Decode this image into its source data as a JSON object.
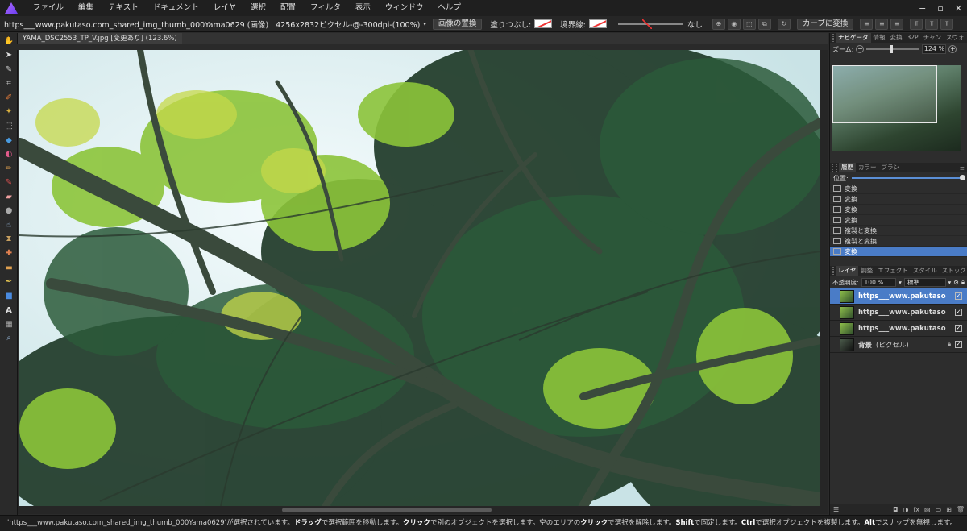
{
  "menu": [
    "ファイル",
    "編集",
    "テキスト",
    "ドキュメント",
    "レイヤ",
    "選択",
    "配置",
    "フィルタ",
    "表示",
    "ウィンドウ",
    "ヘルプ"
  ],
  "window_controls": [
    "−",
    "▫",
    "✕"
  ],
  "context": {
    "doc_name": "https___www.pakutaso.com_shared_img_thumb_000Yama0629 (画像)",
    "doc_info": "4256x2832ピクセル-@-300dpi-(100%)",
    "replace_button": "画像の置換",
    "fill_label": "塗りつぶし:",
    "stroke_label": "境界線:",
    "stroke_none": "なし",
    "convert_curves": "カーブに変換"
  },
  "doc_tab": "YAMA_DSC2553_TP_V.jpg [変更あり] (123.6%)",
  "navigator": {
    "tabs": [
      "ナビゲータ",
      "情報",
      "変換",
      "32P",
      "チャン",
      "スウォ"
    ],
    "active_tab": "ナビゲータ",
    "zoom_label": "ズーム:",
    "zoom_value": "124 %",
    "zoom_level": 0.46
  },
  "history": {
    "tabs": [
      "履歴",
      "カラー",
      "ブラシ"
    ],
    "position_label": "位置:",
    "items": [
      "変換",
      "変換",
      "変換",
      "変換",
      "複製と変換",
      "複製と変換",
      "変換"
    ],
    "selected_index": 6
  },
  "layers": {
    "tabs": [
      "レイヤ",
      "調整",
      "エフェクト",
      "スタイル",
      "ストック"
    ],
    "opacity_label": "不透明度:",
    "opacity_value": "100 %",
    "blend_mode": "標準",
    "items": [
      {
        "name": "https___www.pakutaso",
        "sub": "",
        "selected": true,
        "locked": false
      },
      {
        "name": "https___www.pakutaso",
        "sub": "",
        "selected": false,
        "locked": false
      },
      {
        "name": "https___www.pakutaso",
        "sub": "",
        "selected": false,
        "locked": false
      },
      {
        "name": "背景",
        "sub": "(ピクセル)",
        "selected": false,
        "locked": true
      }
    ]
  },
  "status": {
    "part1": "'https___www.pakutaso.com_shared_img_thumb_000Yama0629'が選択されています。",
    "k1": "ドラッグ",
    "t1": "で選択範囲を移動します。",
    "k2": "クリック",
    "t2": "で別のオブジェクトを選択します。空のエリアの",
    "k3": "クリック",
    "t3": "で選択を解除します。",
    "k4": "Shift",
    "t4": "で固定します。",
    "k5": "Ctrl",
    "t5": "で選択オブジェクトを複製します。",
    "k6": "Alt",
    "t6": "でスナップを無視します。"
  },
  "colors": {
    "accent": "#4a7cc7",
    "foliage_light": "#8cc43a",
    "foliage_dark": "#1f3a28",
    "sky": "#dceff2"
  },
  "tool_icons": [
    "view-hand-icon",
    "move-icon",
    "color-picker-icon",
    "crop-icon",
    "selection-brush-icon",
    "flood-select-icon",
    "marquee-icon",
    "flood-fill-icon",
    "gradient-icon",
    "paint-brush-icon",
    "color-replace-icon",
    "erase-brush-icon",
    "dodge-icon",
    "smudge-icon",
    "clone-icon",
    "blemish-icon",
    "patch-icon",
    "pen-icon",
    "rectangle-icon",
    "artistic-text-icon",
    "mesh-warp-icon",
    "zoom-icon"
  ]
}
